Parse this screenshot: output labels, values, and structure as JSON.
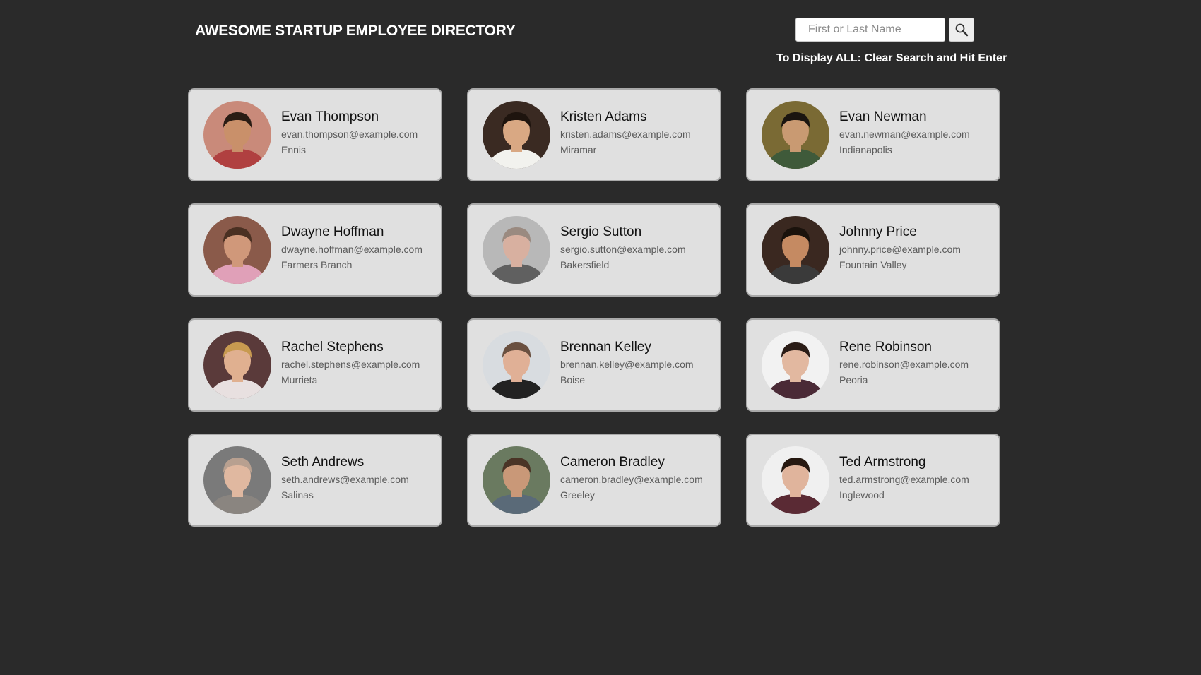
{
  "header": {
    "title": "AWESOME STARTUP EMPLOYEE DIRECTORY",
    "search_placeholder": "First or Last Name",
    "search_value": "",
    "hint": "To Display ALL: Clear Search and Hit Enter"
  },
  "employees": [
    {
      "name": "Evan Thompson",
      "email": "evan.thompson@example.com",
      "city": "Ennis",
      "bg": "#c98a7a",
      "skin": "#c9906a",
      "hair": "#2a1c14",
      "shirt": "#b04040"
    },
    {
      "name": "Kristen Adams",
      "email": "kristen.adams@example.com",
      "city": "Miramar",
      "bg": "#3a2a22",
      "skin": "#d9a883",
      "hair": "#1e140e",
      "shirt": "#f2f2ee"
    },
    {
      "name": "Evan Newman",
      "email": "evan.newman@example.com",
      "city": "Indianapolis",
      "bg": "#7a6a34",
      "skin": "#c99a72",
      "hair": "#1a1510",
      "shirt": "#3f5a3a"
    },
    {
      "name": "Dwayne Hoffman",
      "email": "dwayne.hoffman@example.com",
      "city": "Farmers Branch",
      "bg": "#8a5a4a",
      "skin": "#d0987a",
      "hair": "#4a3022",
      "shirt": "#e0a0b8"
    },
    {
      "name": "Sergio Sutton",
      "email": "sergio.sutton@example.com",
      "city": "Bakersfield",
      "bg": "#b8b8b8",
      "skin": "#d8b0a0",
      "hair": "#9a8a80",
      "shirt": "#606060"
    },
    {
      "name": "Johnny Price",
      "email": "johnny.price@example.com",
      "city": "Fountain Valley",
      "bg": "#3a2820",
      "skin": "#c58a62",
      "hair": "#1a120c",
      "shirt": "#3a3a3a"
    },
    {
      "name": "Rachel Stephens",
      "email": "rachel.stephens@example.com",
      "city": "Murrieta",
      "bg": "#5a3a3a",
      "skin": "#e0b090",
      "hair": "#c89a50",
      "shirt": "#e8e0e0"
    },
    {
      "name": "Brennan Kelley",
      "email": "brennan.kelley@example.com",
      "city": "Boise",
      "bg": "#d8dce0",
      "skin": "#e0b096",
      "hair": "#6a5040",
      "shirt": "#222222"
    },
    {
      "name": "Rene Robinson",
      "email": "rene.robinson@example.com",
      "city": "Peoria",
      "bg": "#f2f2f2",
      "skin": "#e2b8a0",
      "hair": "#2a1c16",
      "shirt": "#4a2a36"
    },
    {
      "name": "Seth Andrews",
      "email": "seth.andrews@example.com",
      "city": "Salinas",
      "bg": "#7a7a7a",
      "skin": "#e0b8a0",
      "hair": "#b8a090",
      "shirt": "#8a8580"
    },
    {
      "name": "Cameron Bradley",
      "email": "cameron.bradley@example.com",
      "city": "Greeley",
      "bg": "#6a7a60",
      "skin": "#c99878",
      "hair": "#4a3426",
      "shirt": "#5a6a78"
    },
    {
      "name": "Ted Armstrong",
      "email": "ted.armstrong@example.com",
      "city": "Inglewood",
      "bg": "#f0f0f0",
      "skin": "#e0b49c",
      "hair": "#261810",
      "shirt": "#5a2a34"
    }
  ]
}
